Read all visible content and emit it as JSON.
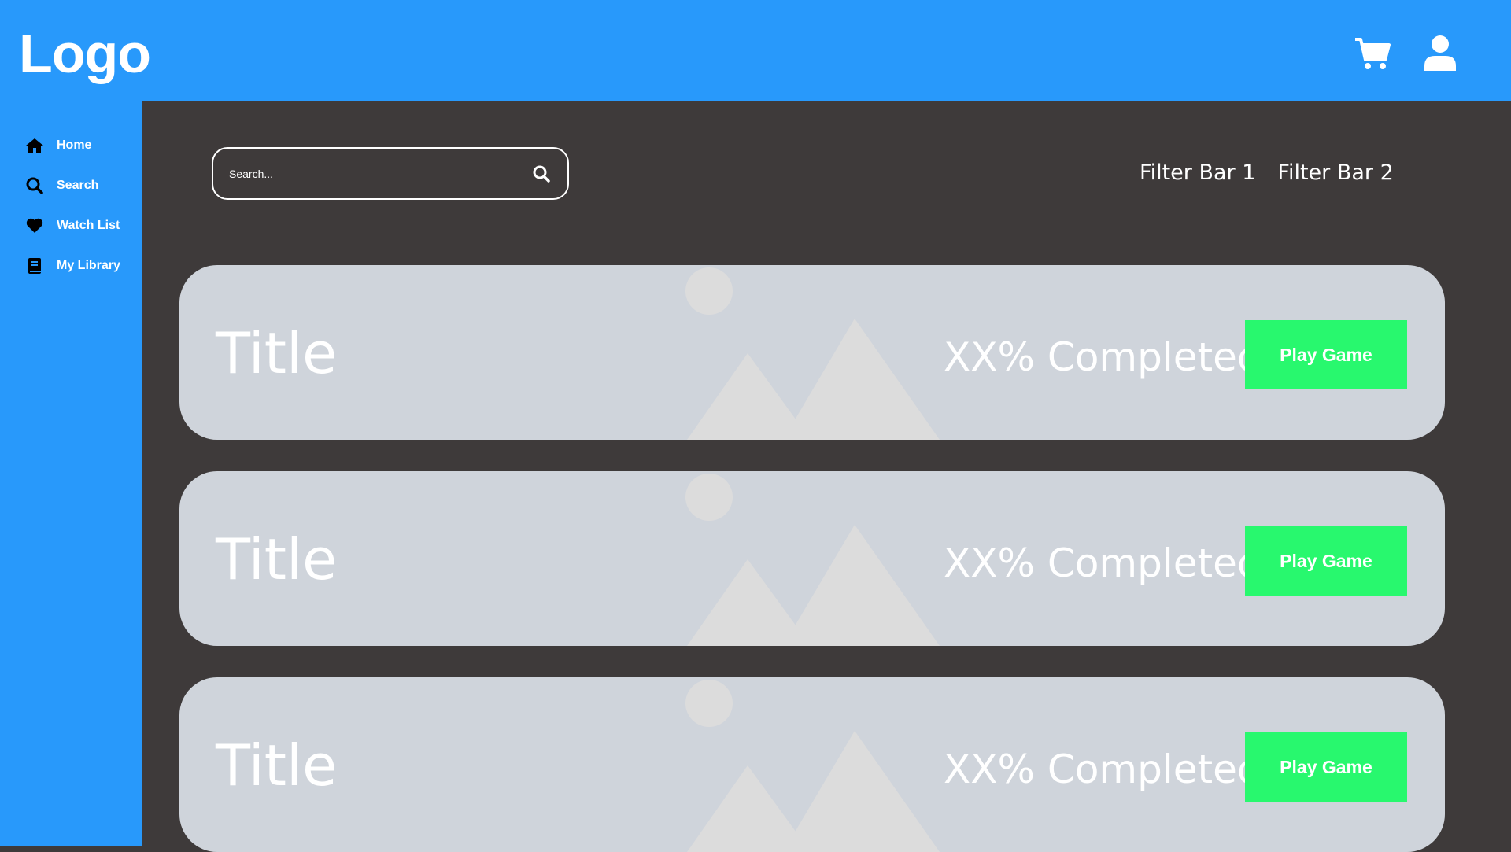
{
  "header": {
    "logo": "Logo"
  },
  "sidebar": {
    "items": [
      {
        "label": "Home",
        "icon": "home-icon"
      },
      {
        "label": "Search",
        "icon": "search-icon"
      },
      {
        "label": "Watch List",
        "icon": "heart-icon"
      },
      {
        "label": "My Library",
        "icon": "book-icon"
      }
    ]
  },
  "search": {
    "placeholder": "Search..."
  },
  "filters": [
    "Filter Bar 1",
    "Filter Bar 2"
  ],
  "cards": [
    {
      "title": "Title",
      "progress": "XX% Completed",
      "button": "Play Game"
    },
    {
      "title": "Title",
      "progress": "XX% Completed",
      "button": "Play Game"
    },
    {
      "title": "Title",
      "progress": "XX% Completed",
      "button": "Play Game"
    }
  ],
  "colors": {
    "brand": "#2899fb",
    "background": "#3e3a3a",
    "card": "#cfd4db",
    "play_button": "#28f86e"
  }
}
